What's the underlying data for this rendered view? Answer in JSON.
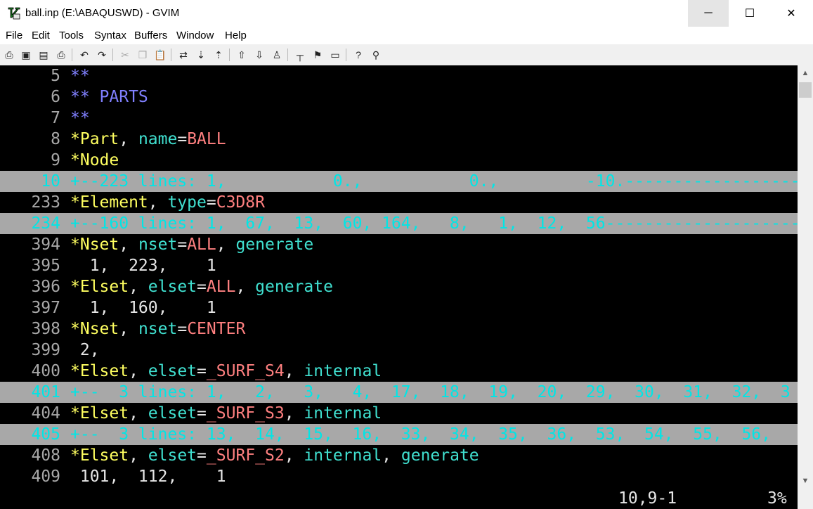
{
  "window": {
    "title": "ball.inp (E:\\ABAQUSWD) - GVIM",
    "minimize_glyph": "─",
    "maximize_glyph": "☐",
    "close_glyph": "✕"
  },
  "menu": [
    "File",
    "Edit",
    "Tools",
    "Syntax",
    "Buffers",
    "Window",
    "Help"
  ],
  "toolbar": {
    "icons": [
      "open-icon",
      "save-icon",
      "save-all-icon",
      "print-icon",
      "undo-icon",
      "redo-icon",
      "cut-icon",
      "copy-icon",
      "paste-icon",
      "find-replace-icon",
      "find-next-icon",
      "find-prev-icon",
      "load-session-icon",
      "save-session-icon",
      "run-script-icon",
      "make-icon",
      "run-ctags-icon",
      "tag-jump-icon",
      "help-icon",
      "find-help-icon"
    ],
    "glyphs": [
      "⎙",
      "▣",
      "▤",
      "⎙",
      "↶",
      "↷",
      "✂",
      "❐",
      "📋",
      "⇄",
      "⇣",
      "⇡",
      "⇧",
      "⇩",
      "♙",
      "┬",
      "⚑",
      "▭",
      "?",
      "⚲"
    ]
  },
  "editor": {
    "lines": [
      {
        "num": "5",
        "fold": false,
        "segments": [
          {
            "t": "**",
            "c": "comment"
          }
        ]
      },
      {
        "num": "6",
        "fold": false,
        "segments": [
          {
            "t": "** PARTS",
            "c": "comment"
          }
        ]
      },
      {
        "num": "7",
        "fold": false,
        "segments": [
          {
            "t": "**",
            "c": "comment"
          }
        ]
      },
      {
        "num": "8",
        "fold": false,
        "segments": [
          {
            "t": "*Part",
            "c": "kw"
          },
          {
            "t": ", ",
            "c": "plain"
          },
          {
            "t": "name",
            "c": "param"
          },
          {
            "t": "=",
            "c": "plain"
          },
          {
            "t": "BALL",
            "c": "val"
          }
        ]
      },
      {
        "num": "9",
        "fold": false,
        "segments": [
          {
            "t": "*Node",
            "c": "kw"
          }
        ]
      },
      {
        "num": "10",
        "fold": true,
        "segments": [
          {
            "t": "+--223 lines: 1,           0.,           0.,         -10.----------------------------",
            "c": "foldtxt"
          }
        ]
      },
      {
        "num": "233",
        "fold": false,
        "segments": [
          {
            "t": "*Element",
            "c": "kw"
          },
          {
            "t": ", ",
            "c": "plain"
          },
          {
            "t": "type",
            "c": "param"
          },
          {
            "t": "=",
            "c": "plain"
          },
          {
            "t": "C3D8R",
            "c": "val"
          }
        ]
      },
      {
        "num": "234",
        "fold": true,
        "segments": [
          {
            "t": "+--160 lines: 1,  67,  13,  60, 164,   8,   1,  12,  56----------------------------",
            "c": "foldtxt"
          }
        ]
      },
      {
        "num": "394",
        "fold": false,
        "segments": [
          {
            "t": "*Nset",
            "c": "kw"
          },
          {
            "t": ", ",
            "c": "plain"
          },
          {
            "t": "nset",
            "c": "param"
          },
          {
            "t": "=",
            "c": "plain"
          },
          {
            "t": "ALL",
            "c": "val"
          },
          {
            "t": ", ",
            "c": "plain"
          },
          {
            "t": "generate",
            "c": "param"
          }
        ]
      },
      {
        "num": "395",
        "fold": false,
        "segments": [
          {
            "t": "  1,  223,    1",
            "c": "plain"
          }
        ]
      },
      {
        "num": "396",
        "fold": false,
        "segments": [
          {
            "t": "*Elset",
            "c": "kw"
          },
          {
            "t": ", ",
            "c": "plain"
          },
          {
            "t": "elset",
            "c": "param"
          },
          {
            "t": "=",
            "c": "plain"
          },
          {
            "t": "ALL",
            "c": "val"
          },
          {
            "t": ", ",
            "c": "plain"
          },
          {
            "t": "generate",
            "c": "param"
          }
        ]
      },
      {
        "num": "397",
        "fold": false,
        "segments": [
          {
            "t": "  1,  160,    1",
            "c": "plain"
          }
        ]
      },
      {
        "num": "398",
        "fold": false,
        "segments": [
          {
            "t": "*Nset",
            "c": "kw"
          },
          {
            "t": ", ",
            "c": "plain"
          },
          {
            "t": "nset",
            "c": "param"
          },
          {
            "t": "=",
            "c": "plain"
          },
          {
            "t": "CENTER",
            "c": "val"
          }
        ]
      },
      {
        "num": "399",
        "fold": false,
        "segments": [
          {
            "t": " 2,",
            "c": "plain"
          }
        ]
      },
      {
        "num": "400",
        "fold": false,
        "segments": [
          {
            "t": "*Elset",
            "c": "kw"
          },
          {
            "t": ", ",
            "c": "plain"
          },
          {
            "t": "elset",
            "c": "param"
          },
          {
            "t": "=",
            "c": "plain"
          },
          {
            "t": "_SURF_S4",
            "c": "val"
          },
          {
            "t": ", ",
            "c": "plain"
          },
          {
            "t": "internal",
            "c": "param"
          }
        ]
      },
      {
        "num": "401",
        "fold": true,
        "segments": [
          {
            "t": "+--  3 lines: 1,   2,   3,   4,  17,  18,  19,  20,  29,  30,  31,  32,  3",
            "c": "foldtxt"
          }
        ]
      },
      {
        "num": "404",
        "fold": false,
        "segments": [
          {
            "t": "*Elset",
            "c": "kw"
          },
          {
            "t": ", ",
            "c": "plain"
          },
          {
            "t": "elset",
            "c": "param"
          },
          {
            "t": "=",
            "c": "plain"
          },
          {
            "t": "_SURF_S3",
            "c": "val"
          },
          {
            "t": ", ",
            "c": "plain"
          },
          {
            "t": "internal",
            "c": "param"
          }
        ]
      },
      {
        "num": "405",
        "fold": true,
        "segments": [
          {
            "t": "+--  3 lines: 13,  14,  15,  16,  33,  34,  35,  36,  53,  54,  55,  56,",
            "c": "foldtxt"
          }
        ]
      },
      {
        "num": "408",
        "fold": false,
        "segments": [
          {
            "t": "*Elset",
            "c": "kw"
          },
          {
            "t": ", ",
            "c": "plain"
          },
          {
            "t": "elset",
            "c": "param"
          },
          {
            "t": "=",
            "c": "plain"
          },
          {
            "t": "_SURF_S2",
            "c": "val"
          },
          {
            "t": ", ",
            "c": "plain"
          },
          {
            "t": "internal",
            "c": "param"
          },
          {
            "t": ", ",
            "c": "plain"
          },
          {
            "t": "generate",
            "c": "param"
          }
        ]
      },
      {
        "num": "409",
        "fold": false,
        "segments": [
          {
            "t": " 101,  112,    1",
            "c": "plain"
          }
        ]
      }
    ],
    "ruler": "10,9-1",
    "percent": "3%"
  },
  "colors": {
    "background": "#000000",
    "line_number": "#a8a8a8",
    "fold_bg": "#a8a8a8",
    "fold_text": "#00e6e6",
    "comment": "#8080ff",
    "keyword": "#ffff60",
    "parameter": "#40e0d0",
    "value": "#ff8080"
  },
  "scrollbar": {
    "up_glyph": "▲",
    "down_glyph": "▼"
  }
}
